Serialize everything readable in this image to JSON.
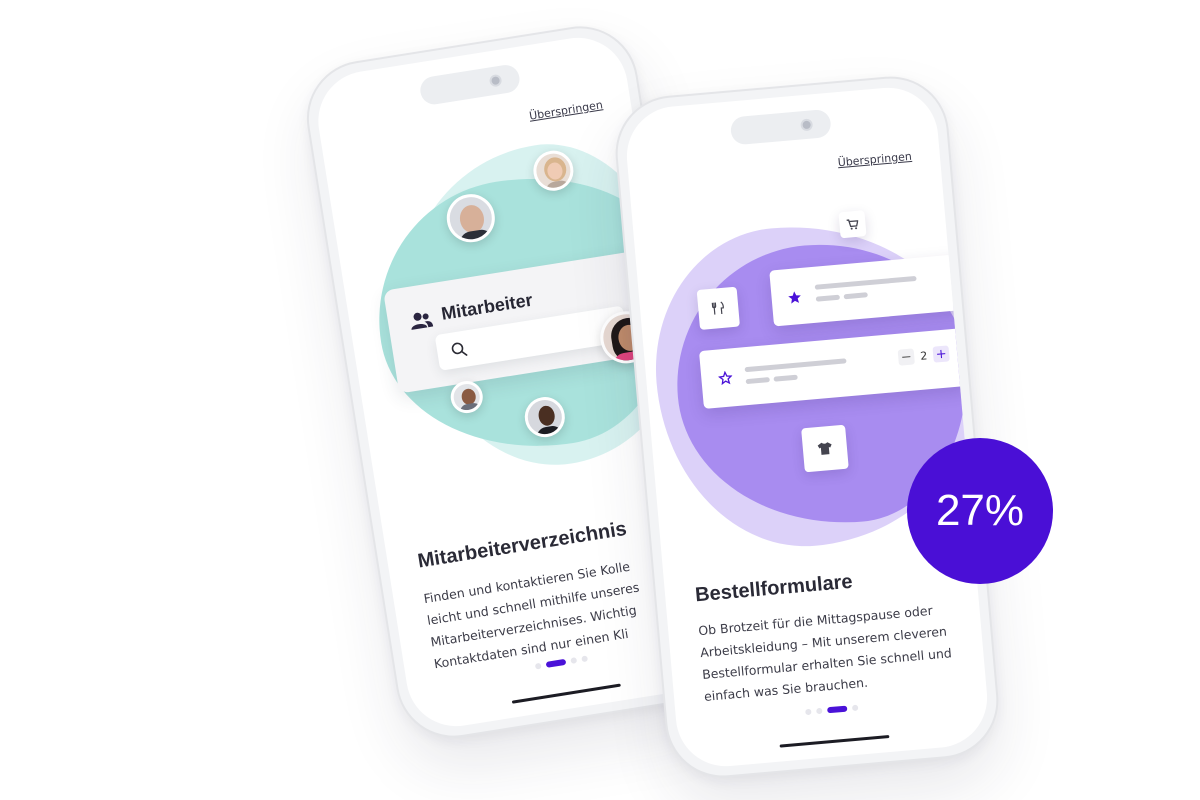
{
  "badge": {
    "text": "27%"
  },
  "colors": {
    "accent": "#4a12d8",
    "teal_blob": "#a9e2dc",
    "purple_blob": "#a88cf0",
    "badge": "#4a0fd6"
  },
  "phone1": {
    "skip_label": "Überspringen",
    "card_title": "Mitarbeiter",
    "card_icon": "people-icon",
    "search_icon": "search-icon",
    "title": "Mitarbeiterverzeichnis",
    "body_lines": [
      "Finden und kontaktieren Sie Kolle",
      "leicht und schnell mithilfe unseres",
      "Mitarbeiterverzeichnises. Wichtig",
      "Kontaktdaten sind nur einen Kli"
    ],
    "page_indicator": {
      "total": 4,
      "active": 1
    }
  },
  "phone2": {
    "skip_label": "Überspringen",
    "icons": [
      "cart-icon",
      "cutlery-icon",
      "star-icon",
      "star-outline-icon",
      "shirt-icon"
    ],
    "stepper_value": "2",
    "stepper_minus": "−",
    "stepper_plus": "+",
    "title": "Bestellformulare",
    "body_lines": [
      "Ob Brotzeit für die Mittagspause oder",
      "Arbeitskleidung –  Mit unserem cleveren",
      "Bestellformular erhalten Sie schnell und",
      "einfach was Sie brauchen."
    ],
    "page_indicator": {
      "total": 4,
      "active": 2
    }
  }
}
